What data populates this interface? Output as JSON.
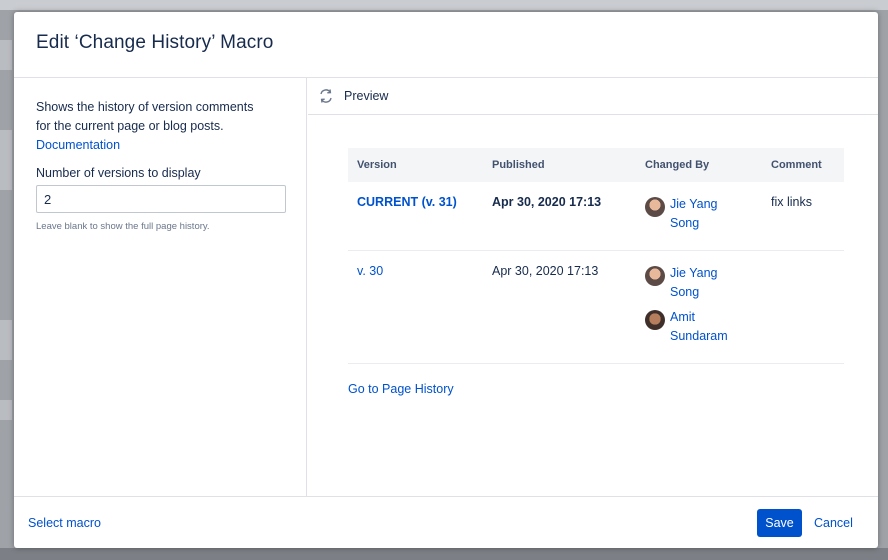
{
  "dialog": {
    "title": "Edit ‘Change History’ Macro"
  },
  "settings": {
    "description": "Shows the history of version comments for the current page or blog posts.",
    "documentation_link": "Documentation",
    "versions_label": "Number of versions to display",
    "versions_value": "2",
    "versions_hint": "Leave blank to show the full page history."
  },
  "preview": {
    "label": "Preview",
    "table": {
      "headers": [
        "Version",
        "Published",
        "Changed By",
        "Comment"
      ],
      "rows": [
        {
          "version": "CURRENT (v. 31)",
          "published": "Apr 30, 2020 17:13",
          "changed_by": [
            "Jie Yang Song"
          ],
          "comment": "fix links"
        },
        {
          "version": "v. 30",
          "published": "Apr 30, 2020 17:13",
          "changed_by": [
            "Jie Yang Song",
            "Amit Sundaram"
          ],
          "comment": ""
        }
      ]
    },
    "page_history_link": "Go to Page History"
  },
  "footer": {
    "select_macro": "Select macro",
    "save": "Save",
    "cancel": "Cancel"
  },
  "colors": {
    "link": "#0052cc",
    "primary_button": "#0052cc",
    "text": "#172b4d"
  }
}
